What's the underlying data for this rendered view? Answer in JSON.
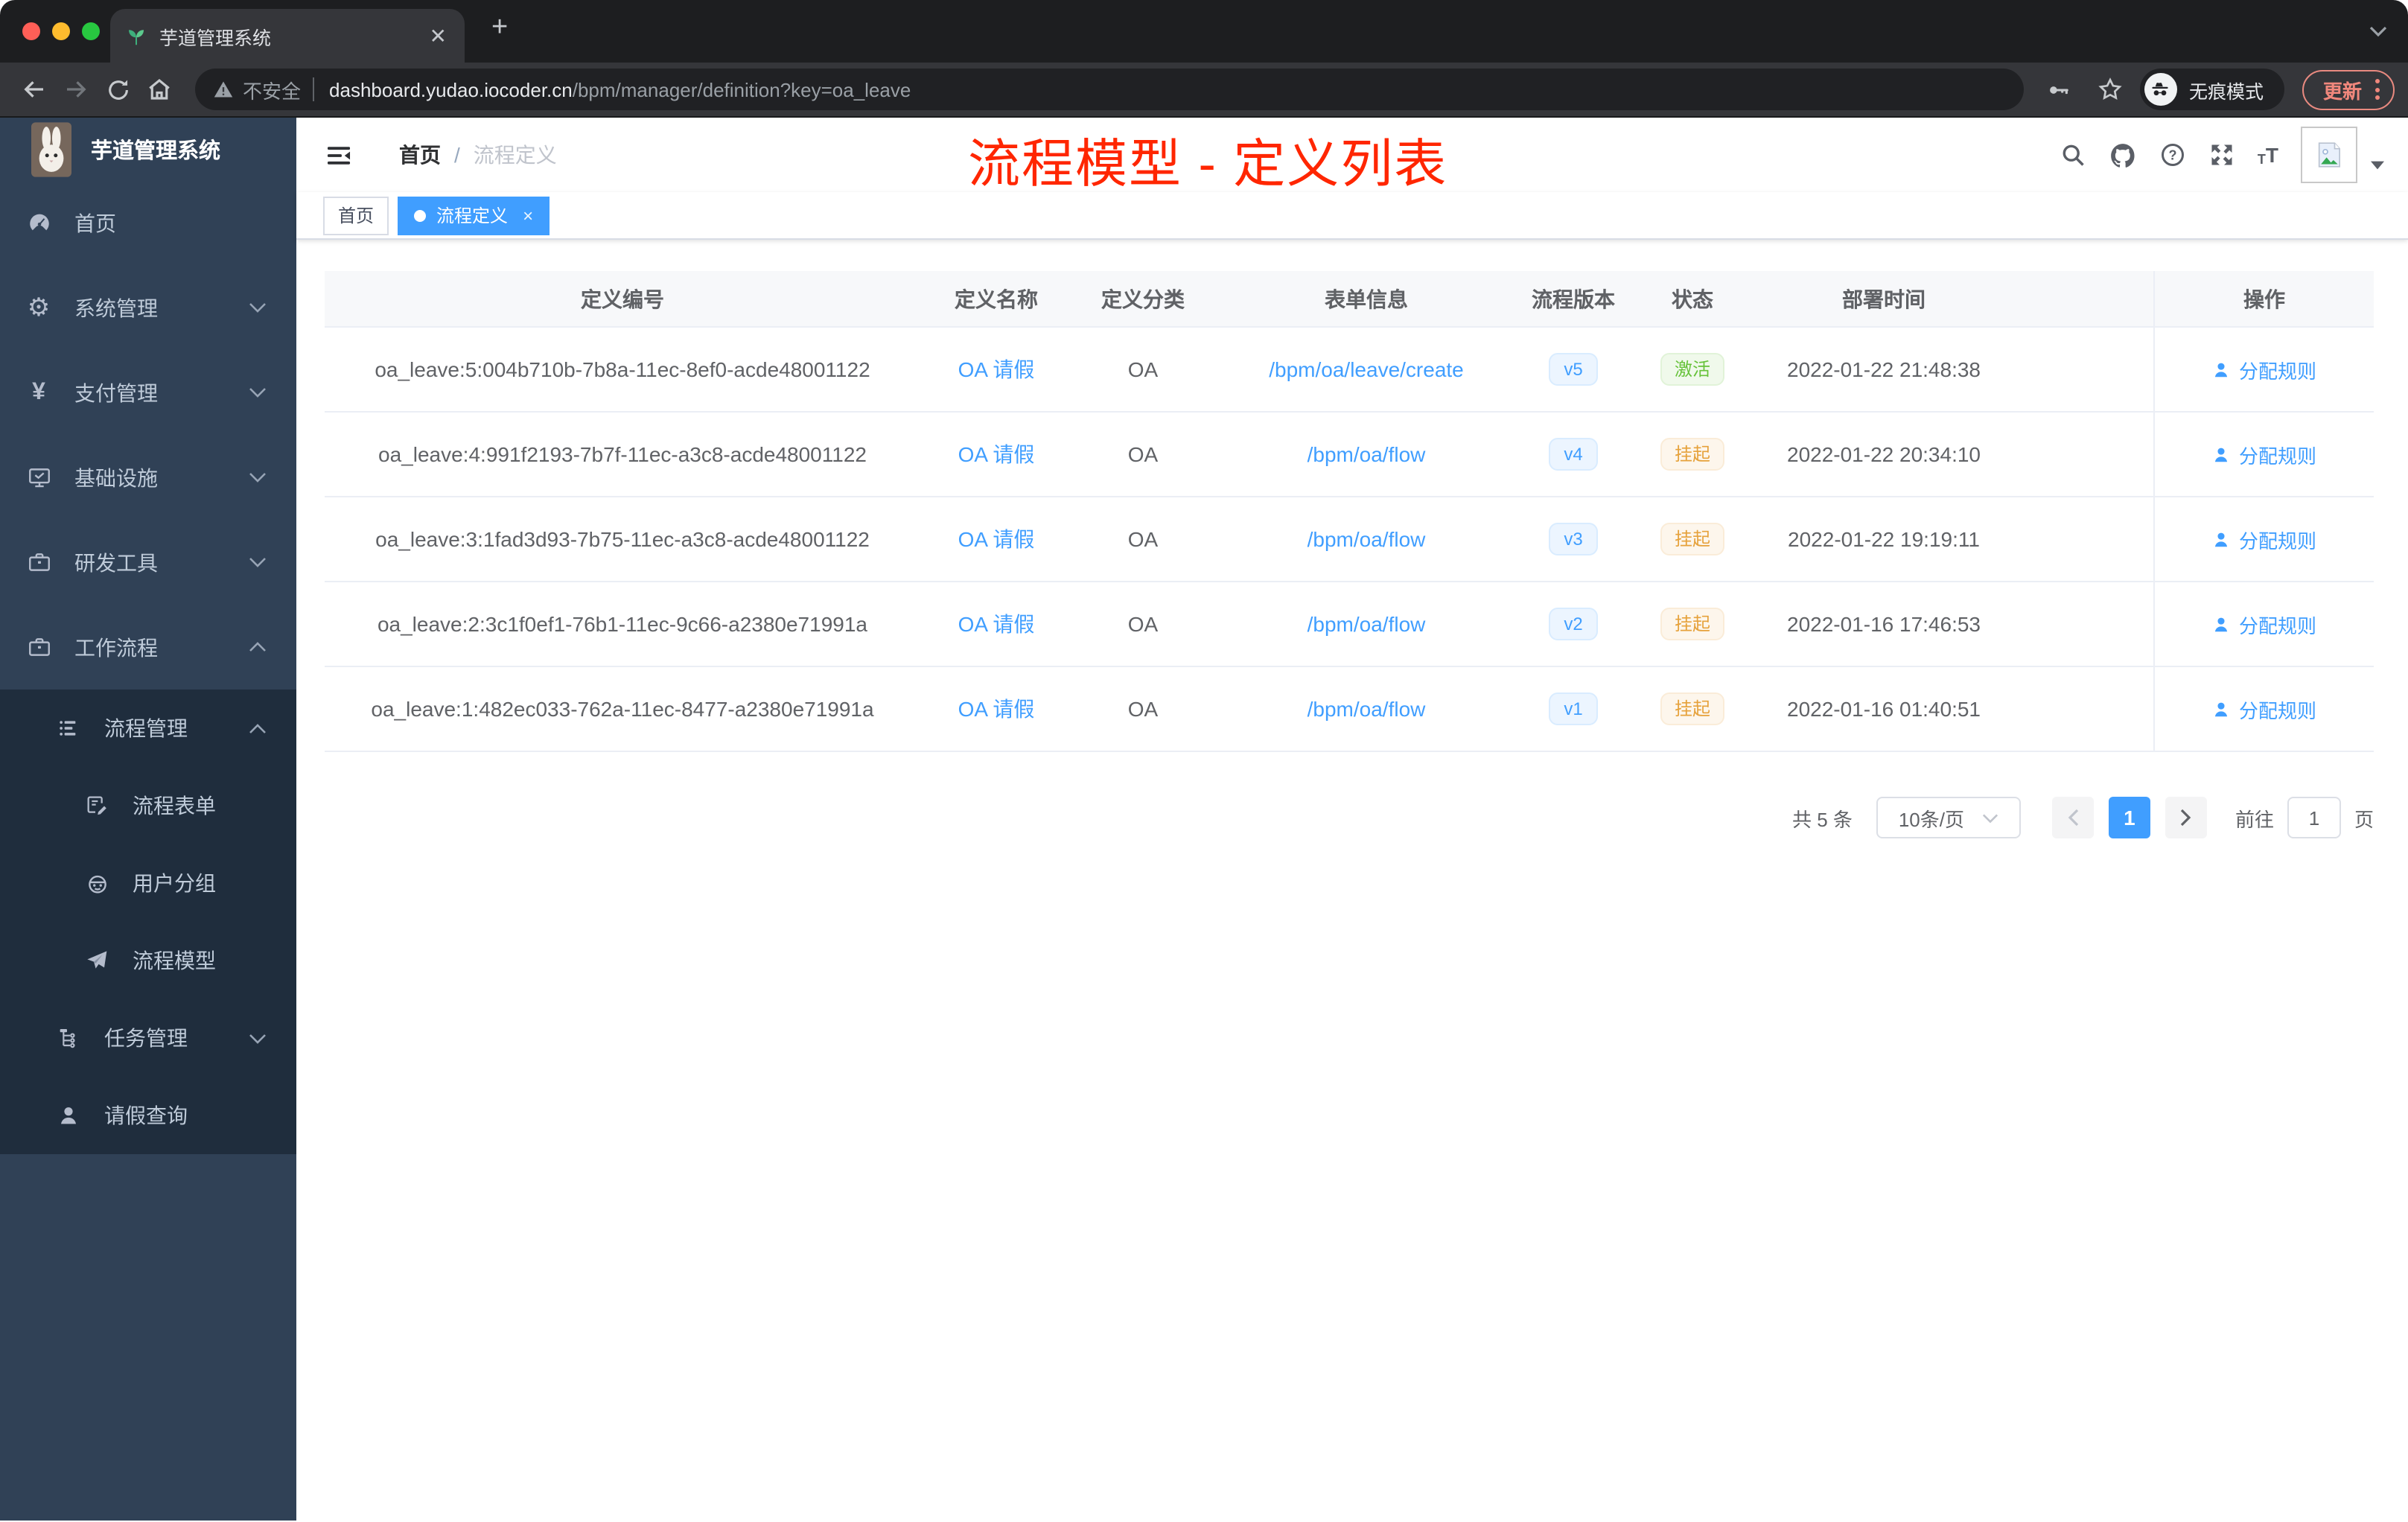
{
  "browser": {
    "tab_title": "芋道管理系统",
    "security_label": "不安全",
    "url_host": "dashboard.yudao.iocoder.cn",
    "url_path": "/bpm/manager/definition?key=oa_leave",
    "incognito_label": "无痕模式",
    "update_label": "更新"
  },
  "annotation": {
    "title": "流程模型 - 定义列表",
    "color": "#ff2600"
  },
  "sidebar": {
    "app_title": "芋道管理系统",
    "items": [
      {
        "name": "home",
        "label": "首页",
        "icon": "gauge-icon",
        "level": 1,
        "chevron": null,
        "dark": false
      },
      {
        "name": "system-management",
        "label": "系统管理",
        "icon": "gear-icon",
        "level": 1,
        "chevron": "down",
        "dark": false
      },
      {
        "name": "payment-management",
        "label": "支付管理",
        "icon": "yen-icon",
        "level": 1,
        "chevron": "down",
        "dark": false
      },
      {
        "name": "infrastructure",
        "label": "基础设施",
        "icon": "monitor-icon",
        "level": 1,
        "chevron": "down",
        "dark": false
      },
      {
        "name": "dev-tools",
        "label": "研发工具",
        "icon": "briefcase-icon",
        "level": 1,
        "chevron": "down",
        "dark": false
      },
      {
        "name": "workflow",
        "label": "工作流程",
        "icon": "briefcase-icon",
        "level": 1,
        "chevron": "up",
        "dark": false
      },
      {
        "name": "process-management",
        "label": "流程管理",
        "icon": "list-icon",
        "level": 2,
        "chevron": "up",
        "dark": true
      },
      {
        "name": "process-form",
        "label": "流程表单",
        "icon": "form-icon",
        "level": 3,
        "chevron": null,
        "dark": true
      },
      {
        "name": "user-group",
        "label": "用户分组",
        "icon": "robot-icon",
        "level": 3,
        "chevron": null,
        "dark": true
      },
      {
        "name": "process-model",
        "label": "流程模型",
        "icon": "paper-plane-icon",
        "level": 3,
        "chevron": null,
        "dark": true
      },
      {
        "name": "task-management",
        "label": "任务管理",
        "icon": "tree-icon",
        "level": 2,
        "chevron": "down",
        "dark": true
      },
      {
        "name": "leave-query",
        "label": "请假查询",
        "icon": "user-icon",
        "level": 2,
        "chevron": null,
        "dark": true
      }
    ]
  },
  "header": {
    "breadcrumb": {
      "home": "首页",
      "separator": "/",
      "current": "流程定义"
    }
  },
  "tags": [
    {
      "name": "home",
      "label": "首页",
      "active": false
    },
    {
      "name": "process-definition",
      "label": "流程定义",
      "active": true
    }
  ],
  "table": {
    "columns": [
      "定义编号",
      "定义名称",
      "定义分类",
      "表单信息",
      "流程版本",
      "状态",
      "部署时间",
      "操作"
    ],
    "rows": [
      {
        "id": "oa_leave:5:004b710b-7b8a-11ec-8ef0-acde48001122",
        "name": "OA 请假",
        "category": "OA",
        "form": "/bpm/oa/leave/create",
        "version": "v5",
        "status": "激活",
        "status_type": "success",
        "time": "2022-01-22 21:48:38",
        "action": "分配规则"
      },
      {
        "id": "oa_leave:4:991f2193-7b7f-11ec-a3c8-acde48001122",
        "name": "OA 请假",
        "category": "OA",
        "form": "/bpm/oa/flow",
        "version": "v4",
        "status": "挂起",
        "status_type": "warning",
        "time": "2022-01-22 20:34:10",
        "action": "分配规则"
      },
      {
        "id": "oa_leave:3:1fad3d93-7b75-11ec-a3c8-acde48001122",
        "name": "OA 请假",
        "category": "OA",
        "form": "/bpm/oa/flow",
        "version": "v3",
        "status": "挂起",
        "status_type": "warning",
        "time": "2022-01-22 19:19:11",
        "action": "分配规则"
      },
      {
        "id": "oa_leave:2:3c1f0ef1-76b1-11ec-9c66-a2380e71991a",
        "name": "OA 请假",
        "category": "OA",
        "form": "/bpm/oa/flow",
        "version": "v2",
        "status": "挂起",
        "status_type": "warning",
        "time": "2022-01-16 17:46:53",
        "action": "分配规则"
      },
      {
        "id": "oa_leave:1:482ec033-762a-11ec-8477-a2380e71991a",
        "name": "OA 请假",
        "category": "OA",
        "form": "/bpm/oa/flow",
        "version": "v1",
        "status": "挂起",
        "status_type": "warning",
        "time": "2022-01-16 01:40:51",
        "action": "分配规则"
      }
    ]
  },
  "pagination": {
    "total": "共 5 条",
    "page_size": "10条/页",
    "current": "1",
    "goto_label": "前往",
    "goto_value": "1",
    "page_label": "页"
  }
}
